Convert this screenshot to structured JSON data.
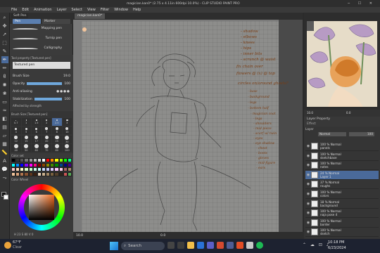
{
  "title": "magician.kan0* (2.75 x 4.11in 600dpi 10.0%) - CLIP STUDIO PAINT PRO",
  "menu": [
    "File",
    "Edit",
    "Animation",
    "Layer",
    "Select",
    "View",
    "Filter",
    "Window",
    "Help"
  ],
  "canvas_tab": "magician.kan0*",
  "subtool": {
    "tab1": "Soft Pen",
    "tab2": "Marker",
    "tab3": "Pen",
    "items": [
      "Mapping pen",
      "Turnip pen",
      "Calligraphy"
    ]
  },
  "toolprop": {
    "header": "Tool property [Textured pen]",
    "title": "Textured pen",
    "brush_size_label": "Brush Size",
    "brush_size": "19.0",
    "opacity_label": "Opacity",
    "opacity": "100",
    "aa_label": "Anti-aliasing",
    "stab_label": "Stabilization",
    "stab": "100",
    "texture_label": "Affected by strength"
  },
  "brushsize": {
    "header": "Brush Size [Textured pen]",
    "sizes": [
      "0.7",
      "1",
      "1.5",
      "2",
      "2.5",
      "3",
      "4",
      "5",
      "6",
      "7",
      "8",
      "10",
      "12",
      "15",
      "17",
      "20",
      "25",
      "30",
      "40",
      "50",
      "60",
      "70",
      "80",
      "100"
    ]
  },
  "colorset": {
    "header": "Color set"
  },
  "colorwheel": {
    "header": "Color Wheel",
    "h": "23",
    "s": "80",
    "v": "0"
  },
  "notes": [
    "- shadow",
    "- elbows",
    "- knees",
    "- hips",
    "- inner bits",
    "- scrunch @ waist",
    "fix chain over",
    "flowers @ (x) @ top",
    "circles on/around ghosts?",
    "- base",
    "- background",
    "- legs",
    "- bottom half",
    "- magician coat",
    "- legs",
    "- shoulders",
    "- mid-piece",
    "- scarf w/ twin",
    "- eyes",
    "- eye shadow",
    "- chest",
    "- boots",
    "- gloves",
    "- mid-figure",
    "- ears"
  ],
  "layer_prop": {
    "tab": "Layer Property",
    "effect": "Effect"
  },
  "layers_header": {
    "tab": "Layer",
    "mode": "Normal",
    "opacity": "100"
  },
  "layers": [
    {
      "line1": "100 % Normal",
      "line2": "panels"
    },
    {
      "line1": "100 % Normal",
      "line2": "sketchbase"
    },
    {
      "line1": "100 % Normal",
      "line2": "notes"
    },
    {
      "line1": "24 % Normal",
      "line2": "Layer 1"
    },
    {
      "line1": "37 % Normal",
      "line2": "roughs"
    },
    {
      "line1": "100 % Normal",
      "line2": "colors"
    },
    {
      "line1": "18 % Normal",
      "line2": "background"
    },
    {
      "line1": "100 % Normal",
      "line2": "naja pose 4"
    },
    {
      "line1": "100 % Normal",
      "line2": "border"
    },
    {
      "line1": "100 % Normal",
      "line2": "sketch"
    }
  ],
  "nav": {
    "zoom": "10.0",
    "angle": "0.0"
  },
  "status": {
    "zoom": "10.0",
    "angle": "0.0"
  },
  "taskbar": {
    "weather_temp": "67°F",
    "weather_desc": "Clear",
    "search": "Search",
    "time": "10:18 PM",
    "date": "6/23/2024"
  },
  "colors": {
    "accent": "#6fa8dc",
    "ink": "#7a3c12",
    "panel": "#3a3a3a",
    "canvas": "#8d8d8b"
  }
}
